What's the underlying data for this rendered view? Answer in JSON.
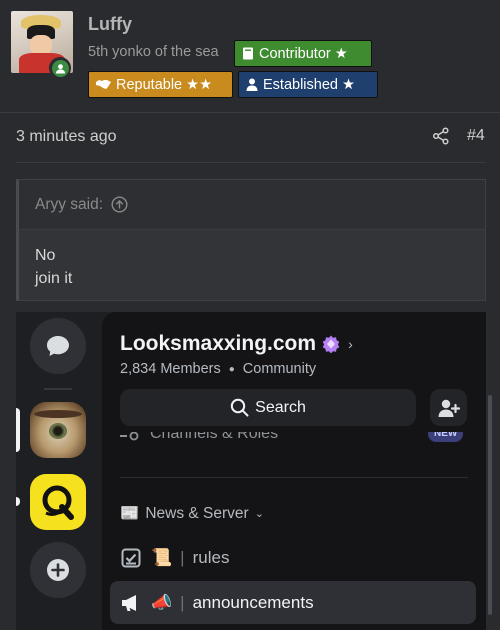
{
  "post": {
    "username": "Luffy",
    "user_title": "5th yonko of the sea",
    "badges": {
      "contributor": "Contributor ★",
      "reputable": "Reputable ★★",
      "established": "Established ★"
    },
    "timestamp": "3 minutes ago",
    "post_number": "#4"
  },
  "quote": {
    "author_label": "Aryy said:",
    "lines": [
      "No",
      "join it"
    ]
  },
  "discord": {
    "server_name": "Looksmaxxing.com",
    "members": "2,834 Members",
    "server_type": "Community",
    "search_label": "Search",
    "cut_item_label": "Channels & Roles",
    "cut_item_badge": "NEW",
    "category": {
      "emoji": "📰",
      "label": "News & Server"
    },
    "channels": [
      {
        "emoji": "📜",
        "name": "rules"
      },
      {
        "emoji": "📣",
        "name": "announcements"
      }
    ]
  },
  "colors": {
    "contributor": "#3e8c2f",
    "reputable": "#c98a1e",
    "established": "#1f3f6e",
    "online": "#3d8a43",
    "server_q_bg": "#f5e11d"
  },
  "icons": [
    "share-icon",
    "arrow-up-circle-icon",
    "chat-bubble-icon",
    "plus-icon",
    "search-icon",
    "add-member-icon",
    "checkbox-icon",
    "megaphone-icon"
  ]
}
